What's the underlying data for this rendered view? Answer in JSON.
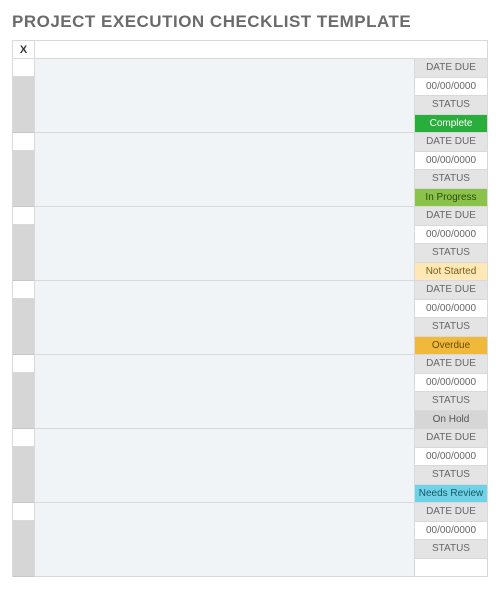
{
  "title": "PROJECT EXECUTION CHECKLIST TEMPLATE",
  "header": {
    "checkCol": "X"
  },
  "labels": {
    "dateDue": "DATE DUE",
    "status": "STATUS",
    "datePlaceholder": "00/00/0000"
  },
  "rows": [
    {
      "status": "Complete",
      "statusClass": "status-complete"
    },
    {
      "status": "In Progress",
      "statusClass": "status-inprogress"
    },
    {
      "status": "Not Started",
      "statusClass": "status-notstarted"
    },
    {
      "status": "Overdue",
      "statusClass": "status-overdue"
    },
    {
      "status": "On Hold",
      "statusClass": "status-onhold"
    },
    {
      "status": "Needs Review",
      "statusClass": "status-needsreview"
    },
    {
      "status": "",
      "statusClass": ""
    }
  ]
}
